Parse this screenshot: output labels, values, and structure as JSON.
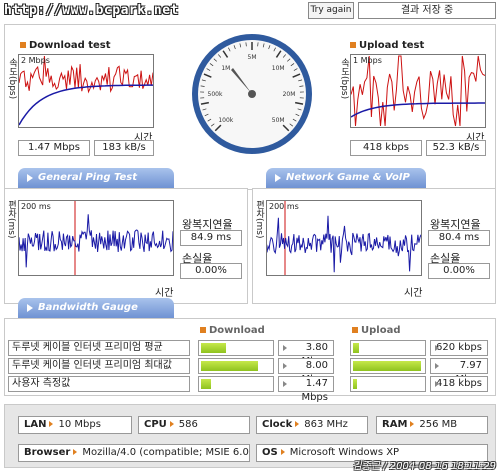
{
  "header": {
    "url": "http://www.bcpark.net",
    "try_again": "Try again",
    "save_status": "결과 저장 중"
  },
  "download": {
    "title": "Download test",
    "ylabel": "속도(bps)",
    "ymax": "2 Mbps",
    "xlabel": "시간",
    "speed": "1.47 Mbps",
    "bytes": "183 kB/s"
  },
  "upload": {
    "title": "Upload test",
    "ylabel": "속도(bps)",
    "ymax": "1 Mbps",
    "xlabel": "시간",
    "speed": "418 kbps",
    "bytes": "52.3 kB/s"
  },
  "gauge": {
    "ticks": [
      "100k",
      "500k",
      "1M",
      "5M",
      "10M",
      "20M",
      "50M"
    ]
  },
  "tabs": {
    "ping": "General Ping Test",
    "game": "Network Game & VoIP Test",
    "bandwidth": "Bandwidth Gauge"
  },
  "ping": {
    "ylabel": "편차(ms)",
    "ymax": "200 ms",
    "xlabel": "시간",
    "latency_label": "왕복지연율",
    "latency": "84.9 ms",
    "loss_label": "손실율",
    "loss": "0.00%"
  },
  "game": {
    "ylabel": "편차(ms)",
    "ymax": "200 ms",
    "xlabel": "시간",
    "latency_label": "왕복지연율",
    "latency": "80.4 ms",
    "loss_label": "손실율",
    "loss": "0.00%"
  },
  "bandwidth": {
    "download_header": "Download",
    "upload_header": "Upload",
    "rows": [
      {
        "label": "두루넷 케이블 인터넷 프리미엄 평균",
        "down": "3.80 Mbps",
        "down_fill": 0.35,
        "up": "620 kbps",
        "up_fill": 0.08
      },
      {
        "label": "두루넷 케이블 인터넷 프리미엄 최대값",
        "down": "8.00 Mbps",
        "down_fill": 0.82,
        "up": "7.97 Mbps",
        "up_fill": 0.97
      },
      {
        "label": "사용자 측정값",
        "down": "1.47 Mbps",
        "down_fill": 0.14,
        "up": "418 kbps",
        "up_fill": 0.05
      }
    ]
  },
  "info": {
    "lan_label": "LAN",
    "lan": "10 Mbps",
    "cpu_label": "CPU",
    "cpu": "586",
    "clock_label": "Clock",
    "clock": "863 MHz",
    "ram_label": "RAM",
    "ram": "256 MB",
    "browser_label": "Browser",
    "browser": "Mozilla/4.0 (compatible; MSIE 6.0",
    "os_label": "OS",
    "os": "Microsoft Windows XP"
  },
  "footer": "김종근 / 2004-08-16 18:11:29",
  "colors": {
    "download_series": "#cc1111",
    "download_avg": "#1a1aa6",
    "ping_series": "#1a1aa6",
    "marker": "#cc1111",
    "bar_fill": "#8fc31f",
    "accent_square": "#e08020"
  }
}
